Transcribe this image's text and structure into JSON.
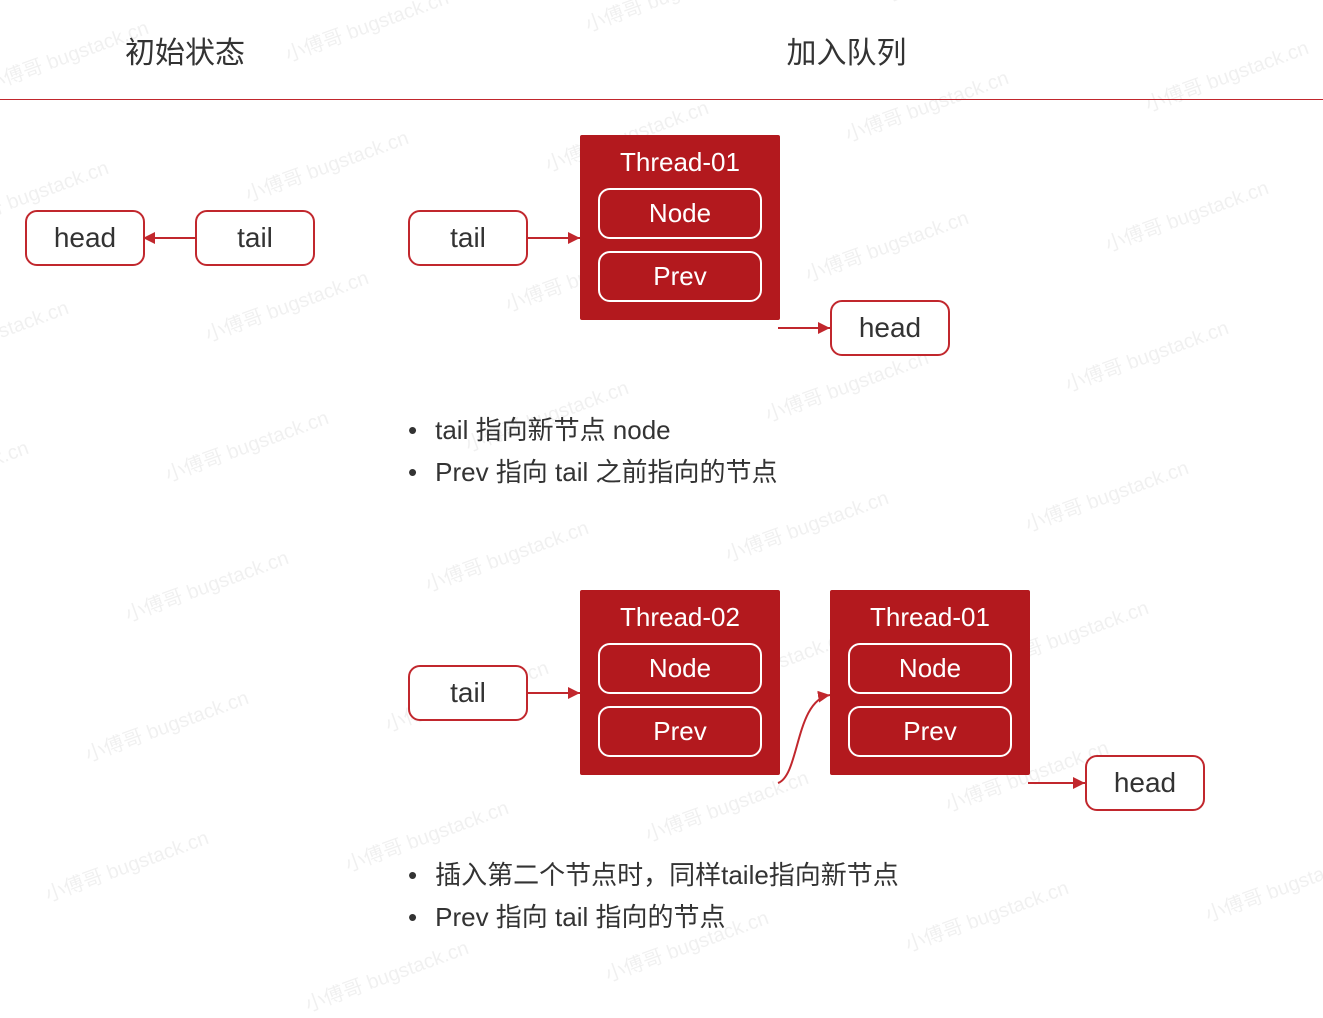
{
  "headers": {
    "left_title": "初始状态",
    "right_title": "加入队列"
  },
  "labels": {
    "head": "head",
    "tail": "tail",
    "node": "Node",
    "prev": "Prev",
    "thread01": "Thread-01",
    "thread02": "Thread-02"
  },
  "bullets1": {
    "b1": "tail 指向新节点 node",
    "b2": "Prev 指向 tail 之前指向的节点"
  },
  "bullets2": {
    "b1": "插入第二个节点时，同样taile指向新节点",
    "b2": "Prev 指向 tail 指向的节点"
  },
  "watermark": "小傅哥 bugstack.cn",
  "colors": {
    "accent": "#c1272d",
    "threadBg": "#b3191e"
  }
}
